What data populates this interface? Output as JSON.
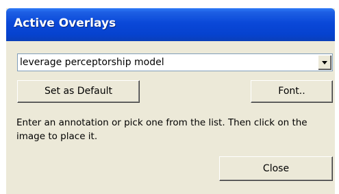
{
  "window": {
    "title": "Active Overlays"
  },
  "annotation_combo": {
    "value": "leverage perceptorship model",
    "dropdown_icon": "chevron-down-icon"
  },
  "buttons": {
    "set_default_label": "Set as Default",
    "font_label": "Font..",
    "close_label": "Close"
  },
  "instructions": {
    "text": "Enter an annotation or pick one from the list.  Then click on the image to place it."
  },
  "colors": {
    "titlebar": "#0642cf",
    "dialog_background": "#ece9d8",
    "input_border": "#7f9db9"
  }
}
